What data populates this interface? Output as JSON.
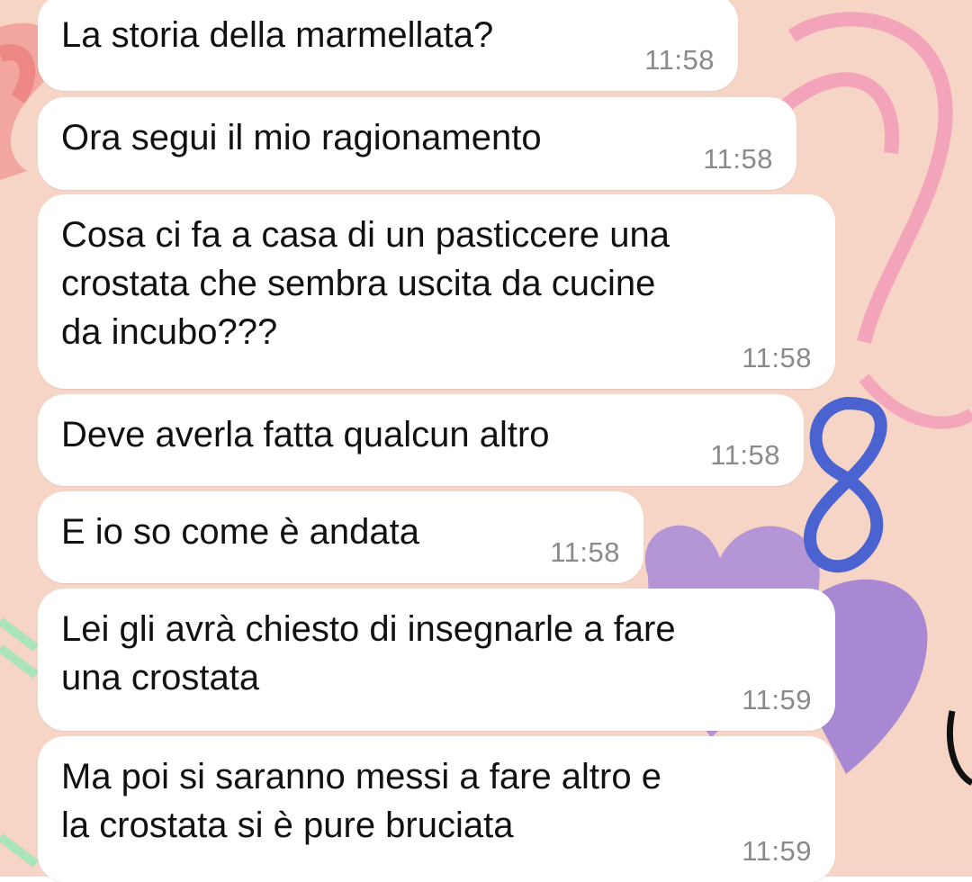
{
  "wallpaper": {
    "background_color": "#f7d5c6",
    "decorations": [
      "red-swirl",
      "pink-heart-outline",
      "purple-heart",
      "green-stripes"
    ]
  },
  "annotation": {
    "text": "8",
    "color": "#4b63d0"
  },
  "messages": [
    {
      "text": "La storia della marmellata?",
      "time": "11:58"
    },
    {
      "text": "Ora segui il mio ragionamento",
      "time": "11:58"
    },
    {
      "text": "Cosa ci fa a casa di un pasticcere una\ncrostata che sembra uscita da cucine\nda incubo???",
      "time": "11:58"
    },
    {
      "text": "Deve averla fatta qualcun altro",
      "time": "11:58"
    },
    {
      "text": "E io so come è andata",
      "time": "11:58"
    },
    {
      "text": "Lei gli avrà chiesto di insegnarle a fare\nuna crostata",
      "time": "11:59"
    },
    {
      "text": "Ma poi si saranno messi a fare altro e\nla crostata si è pure bruciata",
      "time": "11:59"
    }
  ]
}
